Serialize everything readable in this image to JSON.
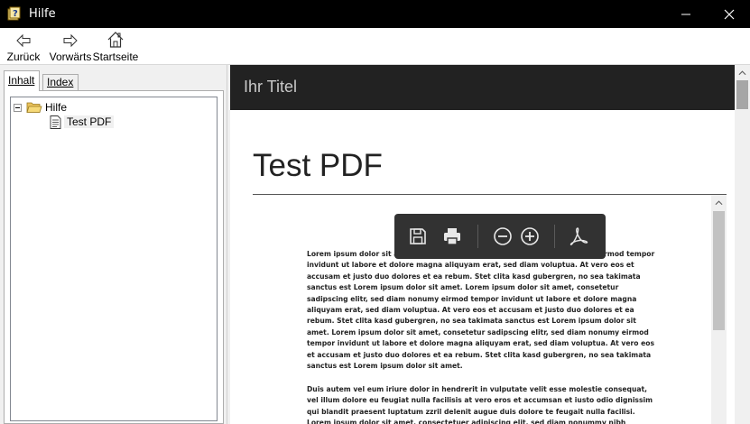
{
  "window": {
    "title": "Hilfe"
  },
  "toolbar": {
    "back_label": "Zurück",
    "forward_label": "Vorwärts",
    "home_label": "Startseite"
  },
  "left_pane": {
    "tabs": [
      {
        "label": "Inhalt",
        "active": true
      },
      {
        "label": "Index",
        "active": false
      }
    ],
    "tree": {
      "root": {
        "label": "Hilfe",
        "icon": "folder-open-icon"
      },
      "children": [
        {
          "label": "Test PDF",
          "icon": "document-icon"
        }
      ]
    }
  },
  "content": {
    "header_title": "Ihr Titel",
    "page_title": "Test PDF",
    "pdf_paragraph_1": "Lorem ipsum dolor sit amet, consetetur sadipscing elitr, sed diam nonumy eirmod tempor invidunt ut labore et dolore magna aliquyam erat, sed diam voluptua. At vero eos et accusam et justo duo dolores et ea rebum. Stet clita kasd gubergren, no sea takimata sanctus est Lorem ipsum dolor sit amet. Lorem ipsum dolor sit amet, consetetur sadipscing elitr, sed diam nonumy eirmod tempor invidunt ut labore et dolore magna aliquyam erat, sed diam voluptua. At vero eos et accusam et justo duo dolores et ea rebum. Stet clita kasd gubergren, no sea takimata sanctus est Lorem ipsum dolor sit amet. Lorem ipsum dolor sit amet, consetetur sadipscing elitr, sed diam nonumy eirmod tempor invidunt ut labore et dolore magna aliquyam erat, sed diam voluptua. At vero eos et accusam et justo duo dolores et ea rebum. Stet clita kasd gubergren, no sea takimata sanctus est Lorem ipsum dolor sit amet.",
    "pdf_paragraph_2": "Duis autem vel eum iriure dolor in hendrerit in vulputate velit esse molestie consequat, vel illum dolore eu feugiat nulla facilisis at vero eros et accumsan et iusto odio dignissim qui blandit praesent luptatum zzril delenit augue duis dolore te feugait nulla facilisi. Lorem ipsum dolor sit amet, consectetuer adipiscing elit, sed diam nonummy nibh euismod tincidunt ut laoreet dolore magna"
  },
  "pdf_toolbar": {
    "tools": [
      "save-icon",
      "print-icon",
      "zoom-out-icon",
      "zoom-in-icon",
      "acrobat-icon"
    ]
  },
  "colors": {
    "titlebar_bg": "#000000",
    "content_header_bg": "#222222",
    "pdf_toolbar_bg": "#323232"
  }
}
